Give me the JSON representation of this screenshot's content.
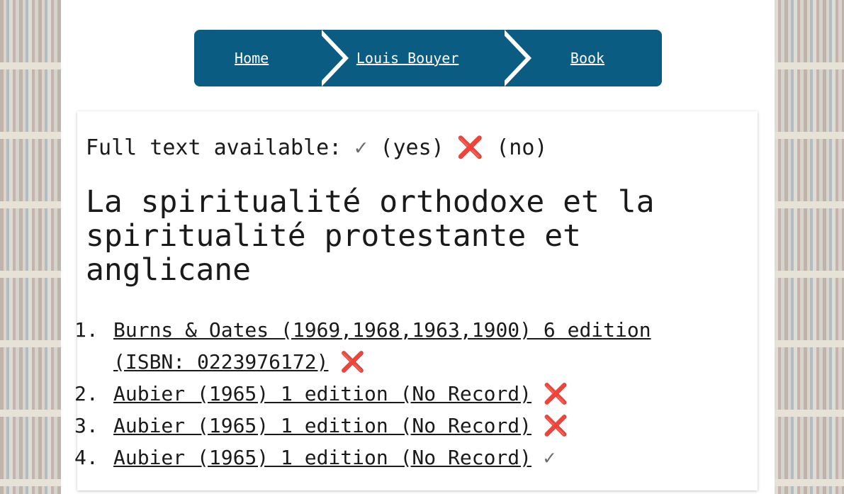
{
  "breadcrumb": {
    "home": "Home",
    "author": "Louis Bouyer",
    "book": "Book"
  },
  "legend": {
    "label": "Full text available:",
    "check_symbol": "✓",
    "yes": "(yes)",
    "cross_symbol": "❌",
    "no": "(no)"
  },
  "book": {
    "title": "La spiritualité orthodoxe et la spiritualité protestante et anglicane"
  },
  "editions": [
    {
      "num": "1.",
      "label": "Burns & Oates (1969,1968,1963,1900) 6 edition (ISBN: 0223976172)",
      "status": "❌"
    },
    {
      "num": "2.",
      "label": "Aubier (1965) 1 edition (No Record)",
      "status": "❌"
    },
    {
      "num": "3.",
      "label": "Aubier (1965) 1 edition (No Record)",
      "status": "❌"
    },
    {
      "num": "4.",
      "label": "Aubier (1965) 1 edition (No Record)",
      "status": "✓"
    }
  ],
  "colors": {
    "accent": "#0b5c82",
    "cross": "#e0232e",
    "check": "#6a6a6a"
  }
}
